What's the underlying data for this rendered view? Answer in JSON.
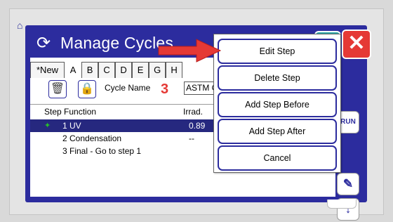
{
  "title": "Manage Cycles",
  "icons": {
    "home": "home-icon",
    "cycle": "cycle-refresh-icon",
    "trash": "trash-icon",
    "lock": "lock-icon",
    "edit": "edit-icon",
    "down": "arrow-down-icon",
    "close": "close-icon",
    "step": "uv-lamp-icon"
  },
  "tabs": [
    "*New",
    "A",
    "B",
    "C",
    "D",
    "E",
    "G",
    "H"
  ],
  "cycle_name_label": "Cycle Name",
  "cycle_name_value": "ASTM G",
  "step_number": "3",
  "list": {
    "header_step": "Step Function",
    "header_irrad": "Irrad.",
    "rows": [
      {
        "name": "1 UV",
        "irrad": "0.89",
        "selected": true
      },
      {
        "name": "2 Condensation",
        "irrad": "--"
      },
      {
        "name": "3 Final - Go to step 1",
        "irrad": ""
      }
    ]
  },
  "side_buttons": {
    "run": "RUN"
  },
  "menu": {
    "items": [
      "Edit Step",
      "Delete Step",
      "Add Step Before",
      "Add Step After",
      "Cancel"
    ]
  },
  "colors": {
    "screen_blue": "#2c2c9e",
    "selected_row": "#26287f",
    "close_red": "#e53935",
    "teal": "#2fa6a6",
    "annotation_red": "#e53935"
  }
}
